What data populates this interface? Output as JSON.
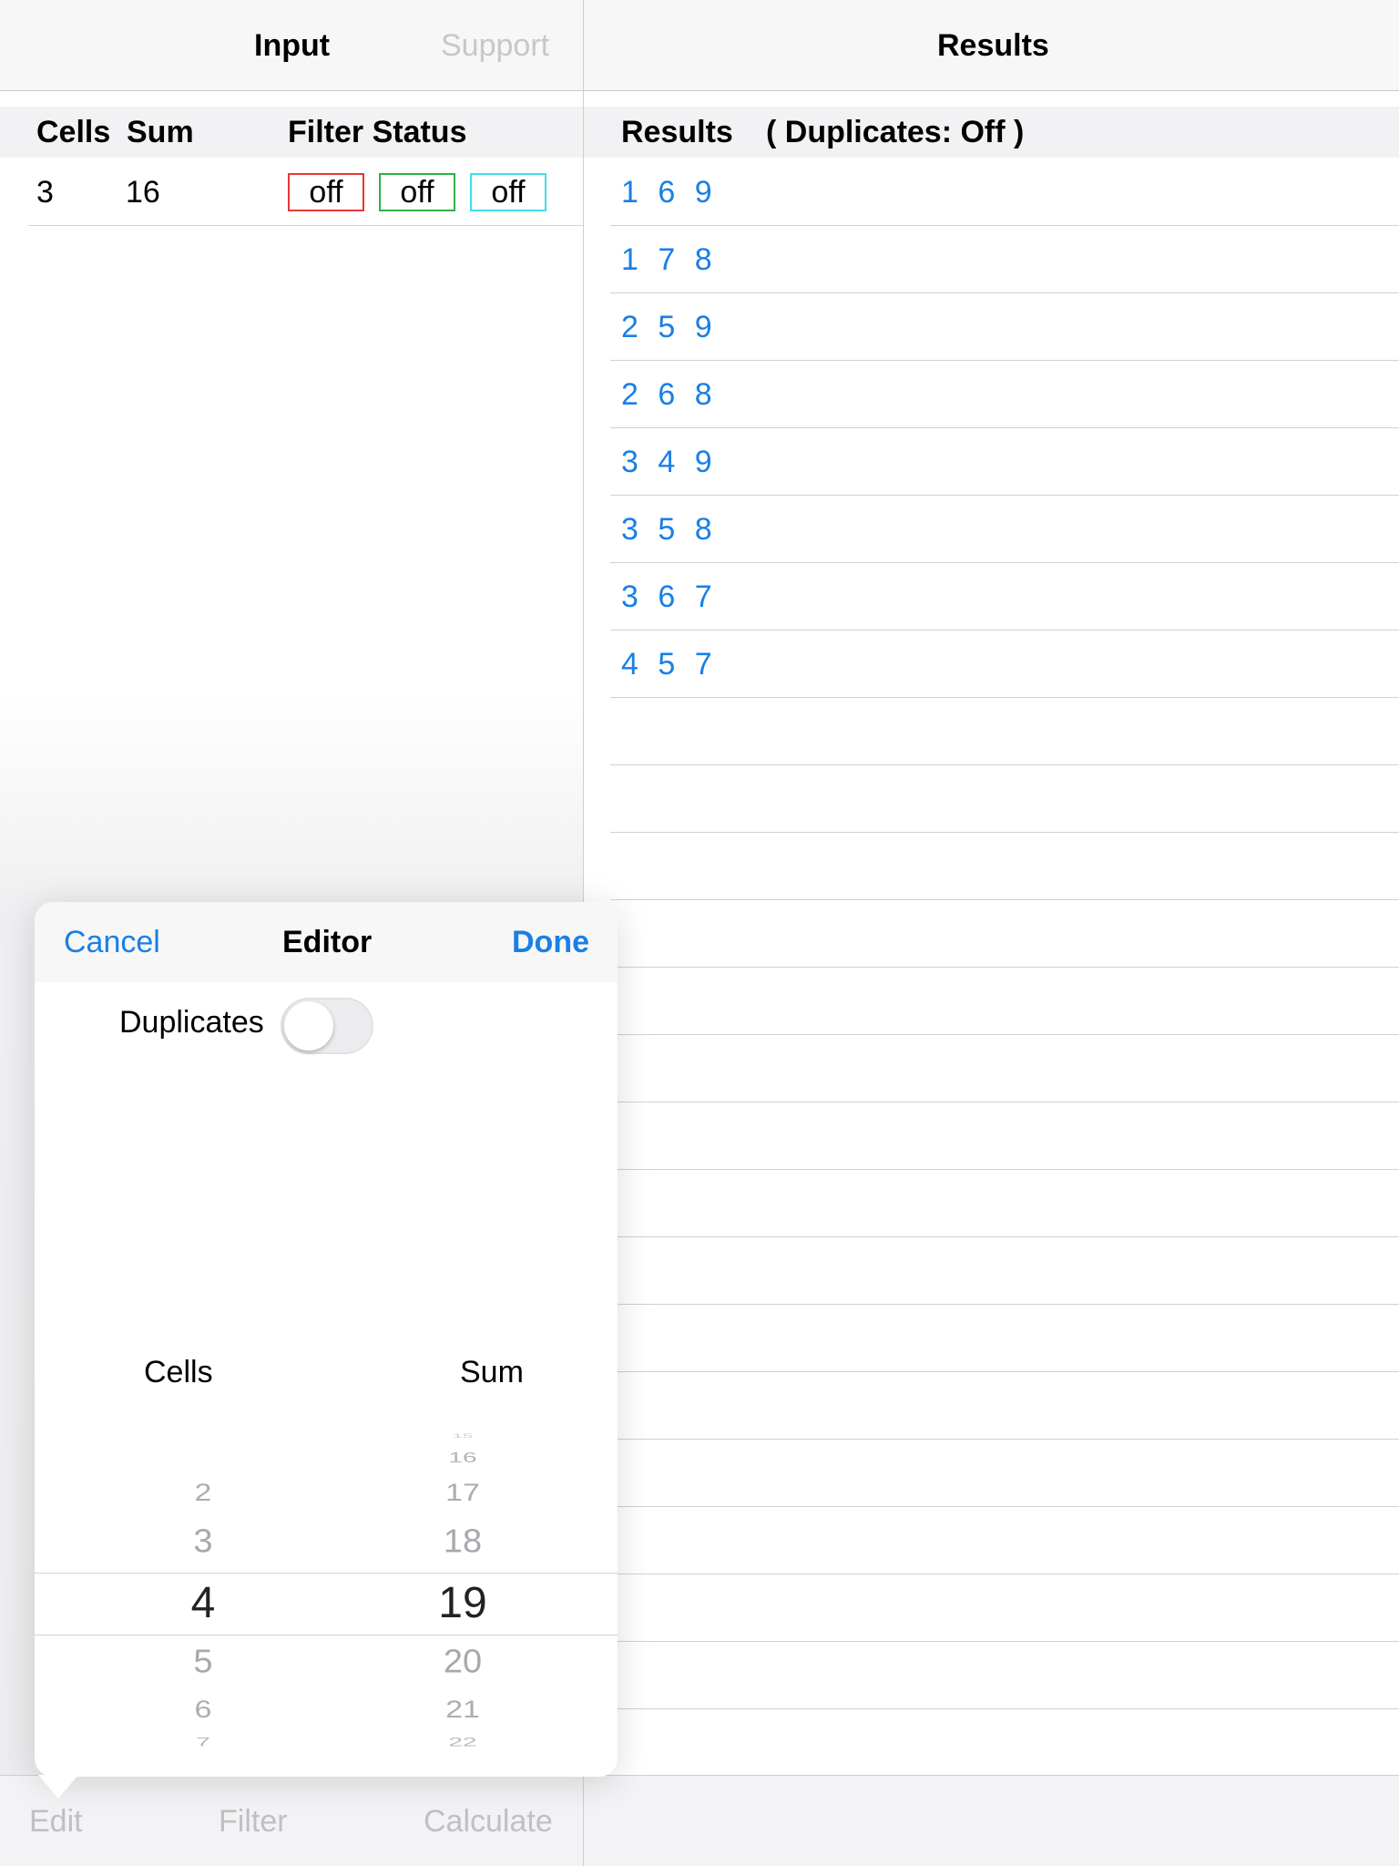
{
  "nav": {
    "input_title": "Input",
    "support_label": "Support",
    "results_title": "Results"
  },
  "input_header": {
    "cells": "Cells",
    "sum": "Sum",
    "filter_status": "Filter Status"
  },
  "input_row": {
    "cells": "3",
    "sum": "16",
    "filters": [
      {
        "label": "off",
        "color": "#e53935"
      },
      {
        "label": "off",
        "color": "#2db14a"
      },
      {
        "label": "off",
        "color": "#3ee0e8"
      }
    ]
  },
  "results_header": {
    "title": "Results",
    "duplicates": "( Duplicates:  Off )"
  },
  "results": [
    "1 6 9",
    "1 7 8",
    "2 5 9",
    "2 6 8",
    "3 4 9",
    "3 5 8",
    "3 6 7",
    "4 5 7"
  ],
  "toolbar": {
    "edit": "Edit",
    "filter": "Filter",
    "calculate": "Calculate"
  },
  "editor": {
    "cancel": "Cancel",
    "title": "Editor",
    "done": "Done",
    "duplicates_label": "Duplicates",
    "duplicates_on": false,
    "cells_label": "Cells",
    "sum_label": "Sum",
    "cells_picker": {
      "above": [
        "2",
        "3"
      ],
      "selected": "4",
      "below": [
        "5",
        "6",
        "7"
      ]
    },
    "sum_picker": {
      "above": [
        "15",
        "16",
        "17",
        "18"
      ],
      "selected": "19",
      "below": [
        "20",
        "21",
        "22"
      ]
    }
  },
  "colors": {
    "accent": "#1a7fe6"
  }
}
